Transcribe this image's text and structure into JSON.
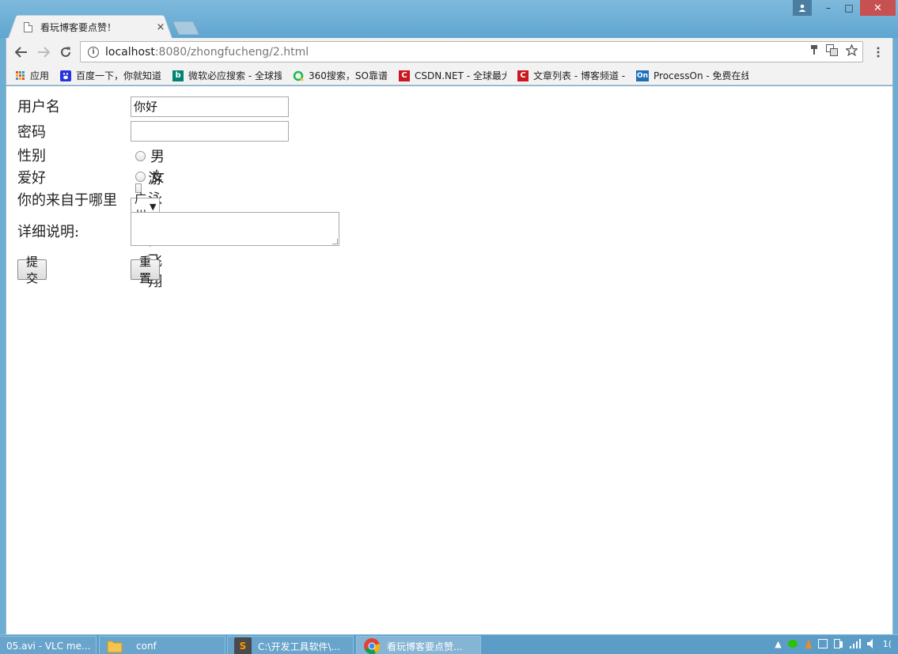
{
  "browser": {
    "tab_title": "看玩博客要点赞！",
    "tab_close": "×",
    "url_host": "localhost",
    "url_rest": ":8080/zhongfucheng/2.html",
    "window_controls": {
      "minimize": "–",
      "maximize": "□",
      "close": "✕"
    }
  },
  "bookmarks": [
    {
      "label": "应用",
      "icon": "apps-icon"
    },
    {
      "label": "百度一下，你就知道",
      "icon": "baidu-icon"
    },
    {
      "label": "微软必应搜索 - 全球搜",
      "icon": "bing-icon"
    },
    {
      "label": "360搜索，SO靠谱",
      "icon": "so360-icon"
    },
    {
      "label": "CSDN.NET - 全球最大",
      "icon": "csdn-icon"
    },
    {
      "label": "文章列表 - 博客频道 -",
      "icon": "csdn-icon"
    },
    {
      "label": "ProcessOn - 免费在线",
      "icon": "processon-icon"
    }
  ],
  "form": {
    "username_label": "用户名",
    "username_value": "你好",
    "password_label": "密码",
    "password_value": "",
    "gender_label": "性别",
    "gender_options": [
      "男",
      "女"
    ],
    "hobby_label": "爱好",
    "hobby_options": [
      "游泳",
      "跑步",
      "飞翔"
    ],
    "origin_label": "你的来自于哪里",
    "origin_selected": "广州",
    "detail_label": "详细说明:",
    "detail_value": "",
    "submit_label": "提交",
    "reset_label": "重置"
  },
  "taskbar": {
    "items": [
      {
        "label": "05.avi - VLC me..."
      },
      {
        "label": "conf"
      },
      {
        "label": "C:\\开发工具软件\\..."
      },
      {
        "label": "看玩博客要点赞..."
      }
    ],
    "clock_fragment": "1("
  },
  "colors": {
    "frame": "#6badd3",
    "close_button": "#c75050",
    "taskbar": "#5c9dc7"
  }
}
